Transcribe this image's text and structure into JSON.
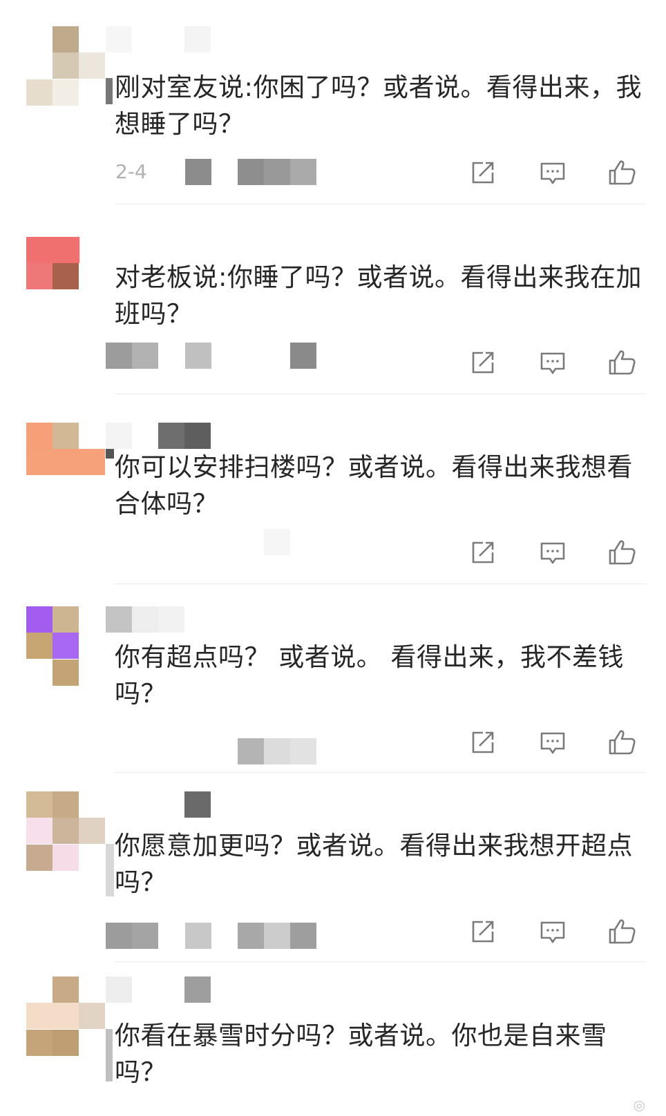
{
  "comments": [
    {
      "text": "刚对室友说:你困了吗？或者说。看得出来，我想睡了吗？",
      "meta": "2-4"
    },
    {
      "text": "对老板说:你睡了吗？或者说。看得出来我在加班吗？",
      "meta": ""
    },
    {
      "text": "你可以安排扫楼吗？或者说。看得出来我想看合体吗？",
      "meta": ""
    },
    {
      "text": "你有超点吗？ 或者说。 看得出来，我不差钱吗？",
      "meta": ""
    },
    {
      "text": "你愿意加更吗？或者说。看得出来我想开超点吗？",
      "meta": ""
    },
    {
      "text": "你看在暴雪时分吗？或者说。你也是自来雪吗？",
      "meta": ""
    }
  ],
  "icons": {
    "share": "share-icon",
    "reply": "comment-icon",
    "like": "thumbs-up-icon"
  },
  "colors": {
    "text": "#262626",
    "icon": "#7a7a7a",
    "divider": "#ececec",
    "blur_gray": "#9a9a9a"
  }
}
